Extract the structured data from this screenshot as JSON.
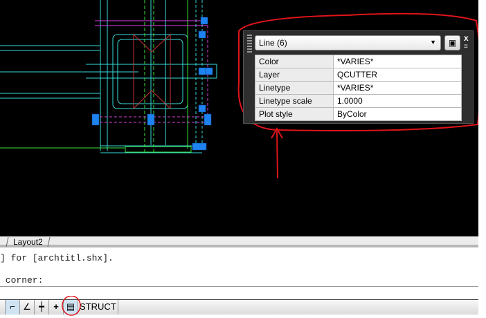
{
  "quick_properties": {
    "selection": "Line (6)",
    "rows": [
      {
        "property": "Color",
        "value": "*VARIES*"
      },
      {
        "property": "Layer",
        "value": "QCUTTER"
      },
      {
        "property": "Linetype",
        "value": "*VARIES*"
      },
      {
        "property": "Linetype scale",
        "value": "1.0000"
      },
      {
        "property": "Plot style",
        "value": "ByColor"
      }
    ],
    "close_glyph": "x",
    "menu_glyph": "≡"
  },
  "layout_tabs": [
    "Layout2"
  ],
  "command_line": {
    "line1": "] for [archtitl.shx].",
    "line2": " corner:"
  },
  "status_bar": {
    "buttons": [
      "ortho-icon",
      "polar-icon",
      "osnap-icon",
      "lineweight-icon",
      "quick-properties-icon"
    ],
    "workspace_label": "STRUCT"
  },
  "colors": {
    "annotation": "#e0141a",
    "grip": "#1e82f0"
  }
}
